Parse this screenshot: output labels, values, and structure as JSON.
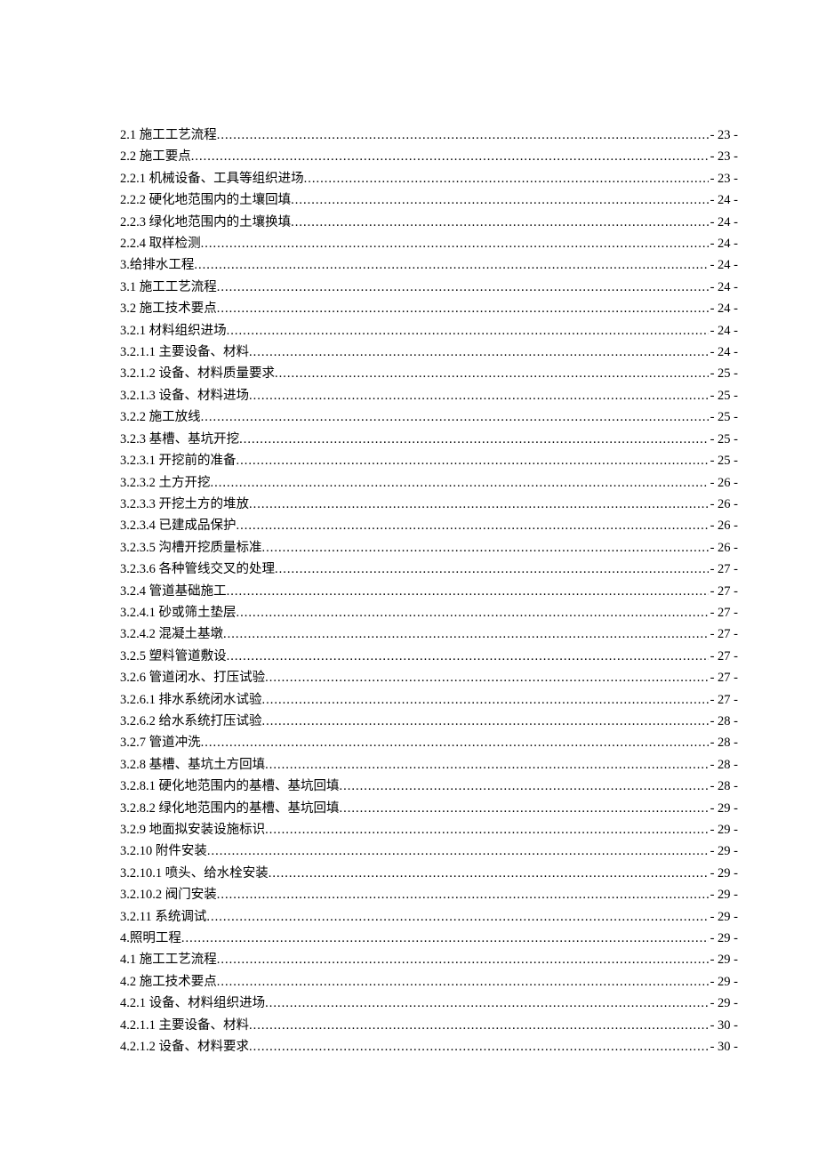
{
  "toc": [
    {
      "title": "2.1 施工工艺流程",
      "page": "23"
    },
    {
      "title": "2.2 施工要点",
      "page": "23"
    },
    {
      "title": "2.2.1 机械设备、工具等组织进场",
      "page": "23"
    },
    {
      "title": "2.2.2 硬化地范围内的土壤回填 ",
      "page": "24"
    },
    {
      "title": "2.2.3 绿化地范围内的土壤换填 ",
      "page": "24"
    },
    {
      "title": "2.2.4 取样检测 ",
      "page": "24"
    },
    {
      "title": "3.给排水工程 ",
      "page": "24"
    },
    {
      "title": "3.1 施工工艺流程 ",
      "page": "24"
    },
    {
      "title": "3.2 施工技术要点 ",
      "page": "24"
    },
    {
      "title": "3.2.1 材料组织进场 ",
      "page": "24"
    },
    {
      "title": "3.2.1.1 主要设备、材料 ",
      "page": "24"
    },
    {
      "title": "3.2.1.2 设备、材料质量要求 ",
      "page": "25"
    },
    {
      "title": "3.2.1.3 设备、材料进场 ",
      "page": "25"
    },
    {
      "title": "3.2.2 施工放线 ",
      "page": "25"
    },
    {
      "title": "3.2.3 基槽、基坑开挖 ",
      "page": "25"
    },
    {
      "title": "3.2.3.1 开挖前的准备 ",
      "page": "25"
    },
    {
      "title": "3.2.3.2 土方开挖 ",
      "page": "26"
    },
    {
      "title": "3.2.3.3 开挖土方的堆放 ",
      "page": "26"
    },
    {
      "title": "3.2.3.4 已建成品保护 ",
      "page": "26"
    },
    {
      "title": "3.2.3.5 沟槽开挖质量标准 ",
      "page": "26"
    },
    {
      "title": "3.2.3.6 各种管线交叉的处理 ",
      "page": "27"
    },
    {
      "title": "3.2.4 管道基础施工",
      "page": "27"
    },
    {
      "title": "3.2.4.1 砂或筛土垫层 ",
      "page": "27"
    },
    {
      "title": "3.2.4.2 混凝土基墩 ",
      "page": "27"
    },
    {
      "title": "3.2.5 塑料管道敷设",
      "page": "27"
    },
    {
      "title": "3.2.6 管道闭水、打压试验",
      "page": "27"
    },
    {
      "title": "3.2.6.1 排水系统闭水试验 ",
      "page": "27"
    },
    {
      "title": "3.2.6.2 给水系统打压试验 ",
      "page": "28"
    },
    {
      "title": "3.2.7 管道冲洗",
      "page": "28"
    },
    {
      "title": "3.2.8 基槽、基坑土方回填 ",
      "page": "28"
    },
    {
      "title": "3.2.8.1 硬化地范围内的基槽、基坑回填 ",
      "page": "28"
    },
    {
      "title": "3.2.8.2 绿化地范围内的基槽、基坑回填 ",
      "page": "29"
    },
    {
      "title": "3.2.9 地面拟安装设施标识 ",
      "page": "29"
    },
    {
      "title": "3.2.10 附件安装 ",
      "page": "29"
    },
    {
      "title": "3.2.10.1 喷头、给水栓安装 ",
      "page": "29"
    },
    {
      "title": "3.2.10.2 阀门安装 ",
      "page": "29"
    },
    {
      "title": "3.2.11 系统调试 ",
      "page": "29"
    },
    {
      "title": "4.照明工程 ",
      "page": "29"
    },
    {
      "title": "4.1 施工工艺流程 ",
      "page": "29"
    },
    {
      "title": "4.2 施工技术要点 ",
      "page": "29"
    },
    {
      "title": "4.2.1 设备、材料组织进场 ",
      "page": "29"
    },
    {
      "title": "4.2.1.1 主要设备、材料 ",
      "page": "30"
    },
    {
      "title": "4.2.1.2 设备、材料要求 ",
      "page": "30"
    }
  ]
}
